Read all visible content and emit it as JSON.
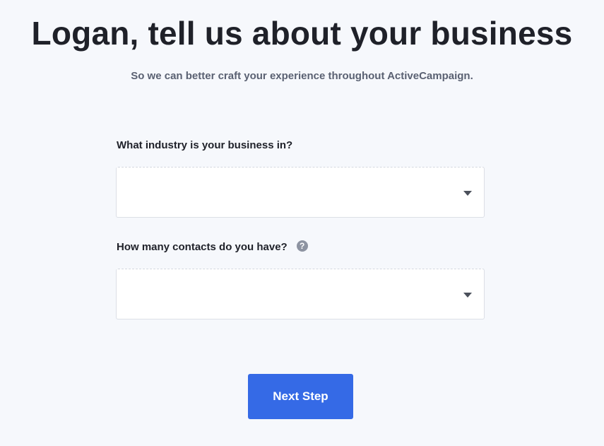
{
  "header": {
    "title": "Logan, tell us about your business",
    "subtitle": "So we can better craft your experience throughout ActiveCampaign."
  },
  "form": {
    "industry": {
      "label": "What industry is your business in?",
      "value": ""
    },
    "contacts": {
      "label": "How many contacts do you have?",
      "help_icon": "?",
      "value": ""
    }
  },
  "actions": {
    "next_label": "Next Step"
  },
  "colors": {
    "background": "#f6f8fc",
    "primary_button": "#356ae6",
    "title_text": "#1f2129",
    "subtitle_text": "#5a6172",
    "help_icon": "#8d93a1"
  },
  "icons": {
    "help": "question-circle-icon",
    "dropdown": "caret-down-icon"
  }
}
